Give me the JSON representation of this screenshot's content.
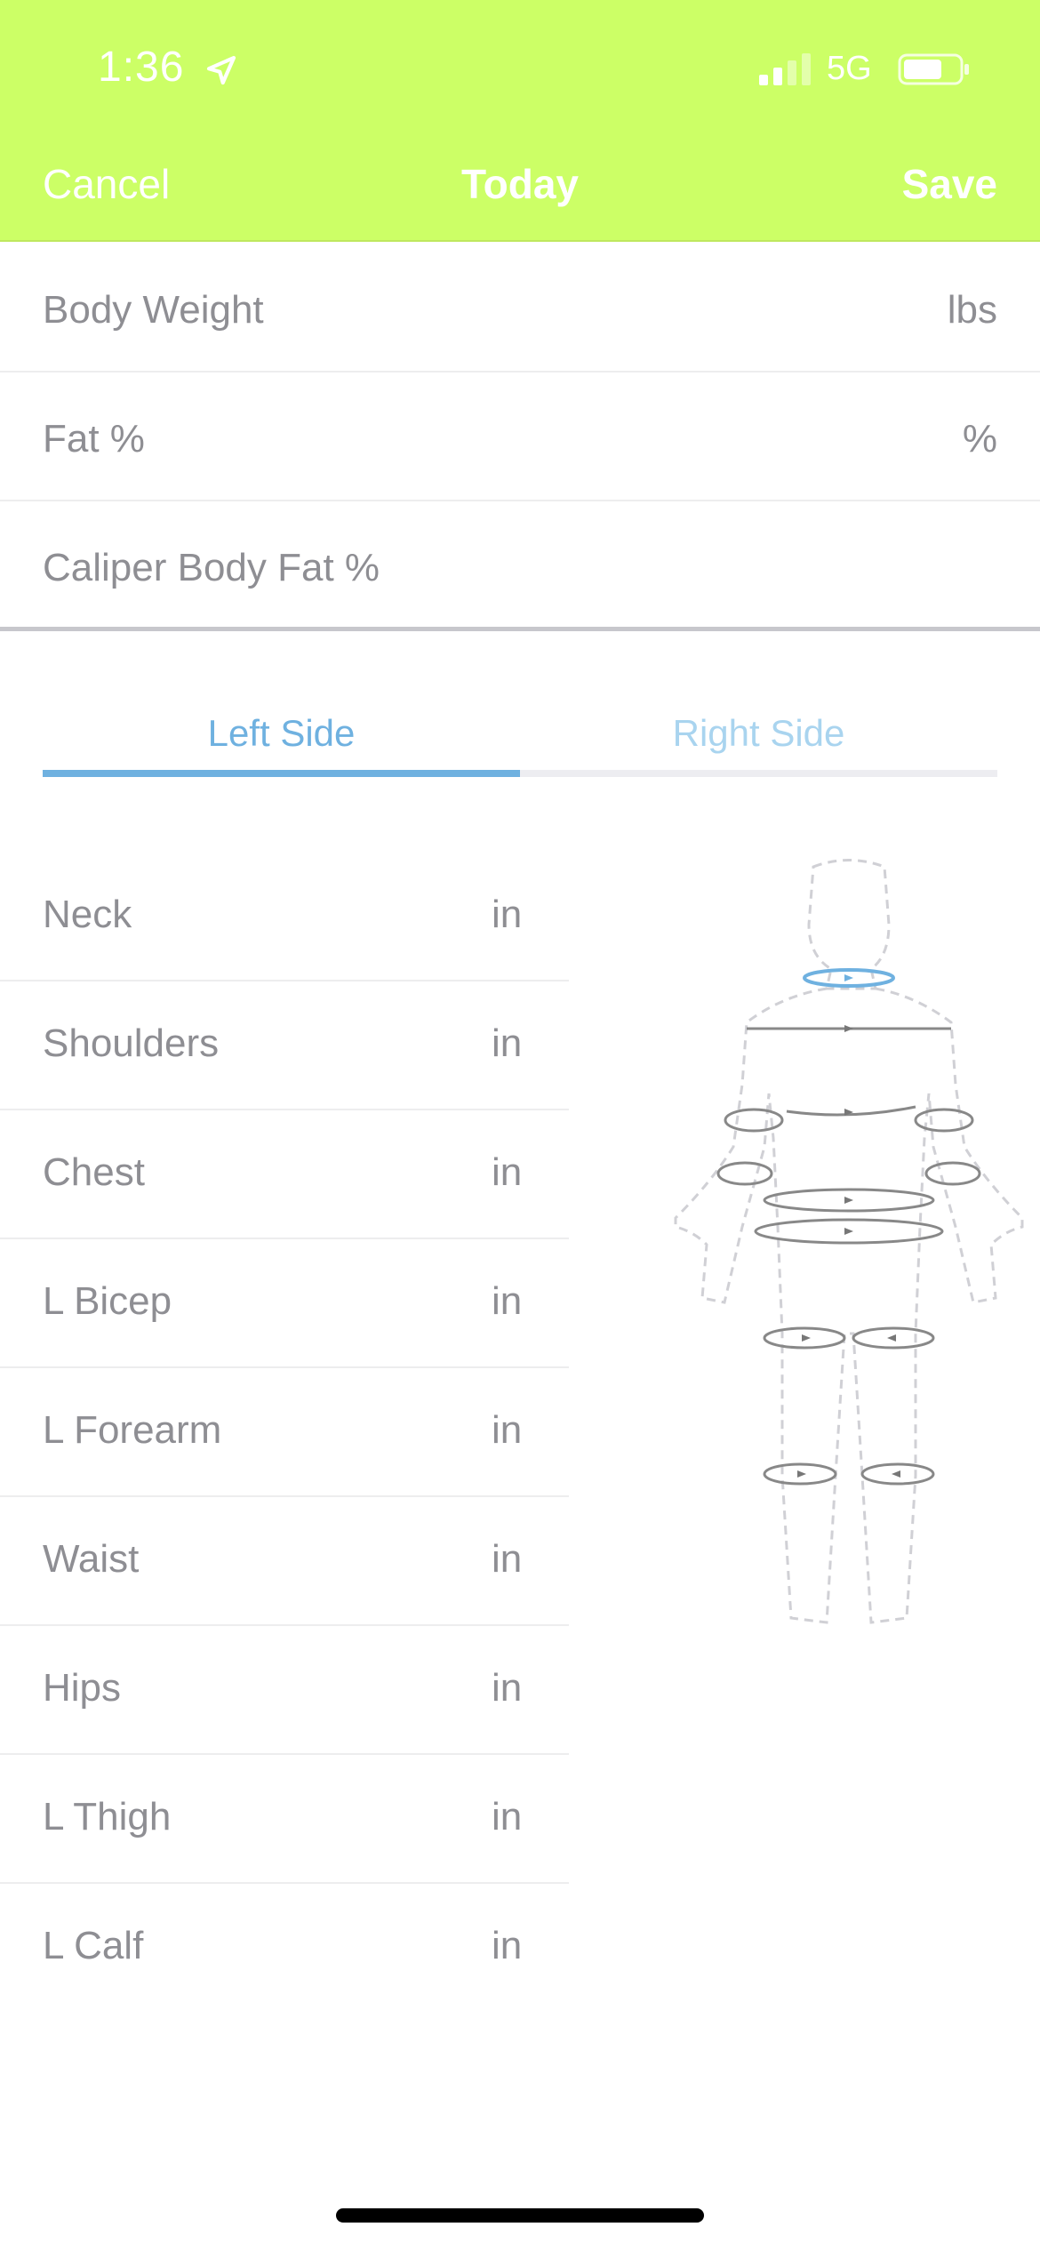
{
  "status_bar": {
    "time": "1:36",
    "network": "5G"
  },
  "nav": {
    "cancel": "Cancel",
    "title": "Today",
    "save": "Save"
  },
  "top_fields": [
    {
      "label": "Body Weight",
      "unit": "lbs"
    },
    {
      "label": "Fat %",
      "unit": "%"
    },
    {
      "label": "Caliper Body Fat %",
      "unit": ""
    }
  ],
  "tabs": {
    "left": "Left Side",
    "right": "Right Side",
    "selected": "left"
  },
  "measurements": [
    {
      "label": "Neck",
      "unit": "in"
    },
    {
      "label": "Shoulders",
      "unit": "in"
    },
    {
      "label": "Chest",
      "unit": "in"
    },
    {
      "label": "L Bicep",
      "unit": "in"
    },
    {
      "label": "L Forearm",
      "unit": "in"
    },
    {
      "label": "Waist",
      "unit": "in"
    },
    {
      "label": "Hips",
      "unit": "in"
    },
    {
      "label": "L Thigh",
      "unit": "in"
    },
    {
      "label": "L Calf",
      "unit": "in"
    }
  ],
  "colors": {
    "header_bg": "#ccff66",
    "accent": "#6fb1e0",
    "text": "#8e8e93"
  },
  "icons": {
    "location": "location-arrow-icon",
    "signal": "cell-signal-icon",
    "battery": "battery-icon",
    "body": "body-measurement-diagram"
  }
}
